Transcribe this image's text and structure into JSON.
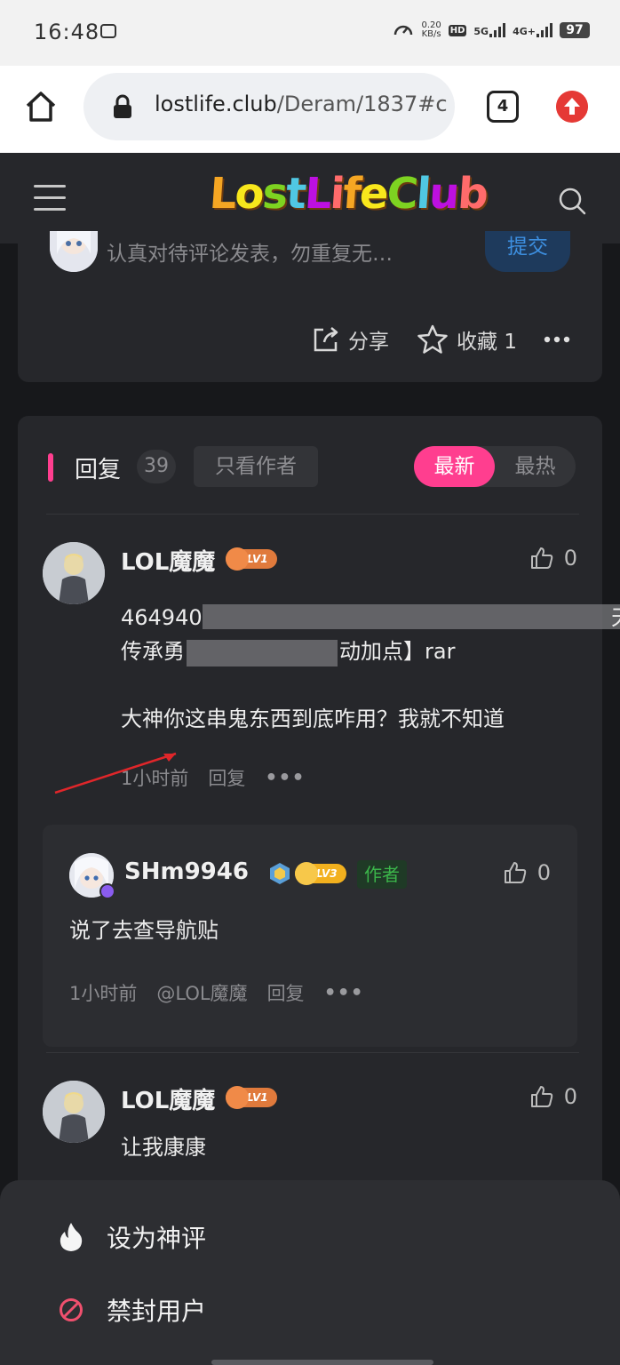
{
  "status_bar": {
    "time": "16:48",
    "speed_value": "0.20",
    "speed_unit": "KB/s",
    "hd_label": "HD",
    "network_5g": "5G",
    "network_4g": "4G+",
    "battery": "97"
  },
  "browser": {
    "url_domain": "lostlife.club",
    "url_path": "/Deram/1837#c",
    "tab_count": "4"
  },
  "site": {
    "logo_text": "LostLifeClub",
    "logo_colors": [
      "#f5a623",
      "#f8e71c",
      "#7ed321",
      "#50c8e3",
      "#bd10e0",
      "#ff6b6b"
    ]
  },
  "comment_box": {
    "placeholder": "认真对待评论发表，勿重复无…",
    "submit_label": "提交",
    "share_label": "分享",
    "favorite_label": "收藏 1"
  },
  "replies": {
    "title": "回复",
    "count": "39",
    "author_only": "只看作者",
    "sort_newest": "最新",
    "sort_hottest": "最热",
    "items": [
      {
        "username": "LOL魔魔",
        "level": "LV1",
        "likes": "0",
        "text_line1": "464940",
        "text_line1_tail": "天",
        "text_line2_head": "传承勇",
        "text_line2_tail": "动加点】rar",
        "text_line3": "大神你这串鬼东西到底咋用？我就不知道",
        "time": "1小时前",
        "reply_label": "回复"
      },
      {
        "username": "LOL魔魔",
        "level": "LV1",
        "likes": "0",
        "text": "让我康康"
      }
    ],
    "sub_reply": {
      "username": "SHm9946",
      "level": "LV3",
      "badge": "作者",
      "likes": "0",
      "text": "说了去查导航贴",
      "time": "1小时前",
      "mention": "@LOL魔魔",
      "reply_label": "回复"
    }
  },
  "action_sheet": {
    "set_hot_label": "设为神评",
    "ban_user_label": "禁封用户"
  },
  "colors": {
    "accent_pink": "#ff3e8f",
    "link_blue": "#3d8fe0",
    "author_green": "#3bb54a",
    "lv1_orange": "#e07a3c",
    "lv3_gold": "#f2b01e"
  }
}
